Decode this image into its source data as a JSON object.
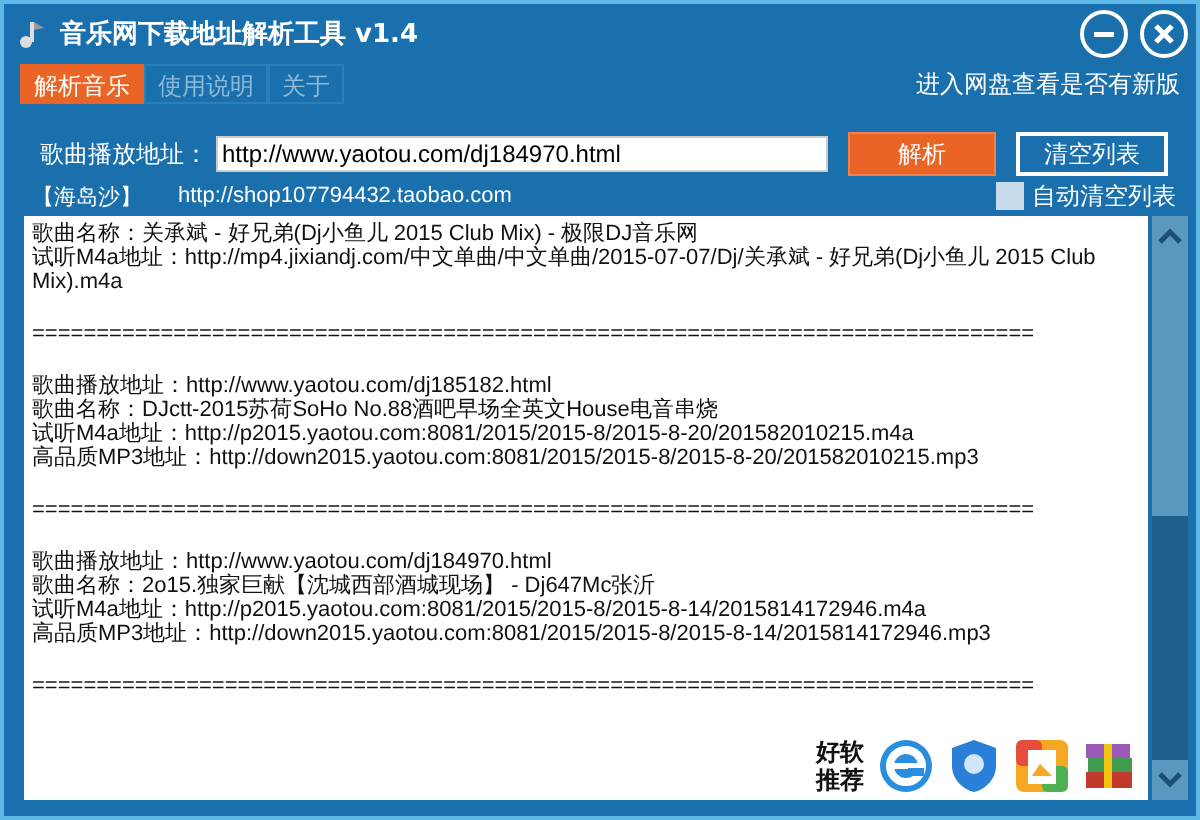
{
  "window": {
    "title": "音乐网下载地址解析工具 v1.4"
  },
  "tabs": [
    {
      "label": "解析音乐",
      "selected": true
    },
    {
      "label": "使用说明",
      "selected": false
    },
    {
      "label": "关于",
      "selected": false
    }
  ],
  "update_link": "进入网盘查看是否有新版",
  "url_label": "歌曲播放地址：",
  "url_value": "http://www.yaotou.com/dj184970.html",
  "parse_button": "解析",
  "clear_button": "清空列表",
  "shop_name": "【海岛沙】",
  "shop_link": "http://shop107794432.taobao.com",
  "auto_clear": {
    "label": "自动清空列表",
    "checked": false
  },
  "log": [
    {
      "kind": "entry",
      "lines": [
        "歌曲名称：关承斌 - 好兄弟(Dj小鱼儿 2015 Club Mix) - 极限DJ音乐网",
        "试听M4a地址：http://mp4.jixiandj.com/中文单曲/中文单曲/2015-07-07/Dj/关承斌 - 好兄弟(Dj小鱼儿 2015 Club Mix).m4a"
      ]
    },
    {
      "kind": "separator",
      "text": "=============================================================================="
    },
    {
      "kind": "entry",
      "lines": [
        "歌曲播放地址：http://www.yaotou.com/dj185182.html",
        "歌曲名称：DJctt-2015苏荷SoHo No.88酒吧早场全英文House电音串烧",
        "试听M4a地址：http://p2015.yaotou.com:8081/2015/2015-8/2015-8-20/201582010215.m4a",
        "高品质MP3地址：http://down2015.yaotou.com:8081/2015/2015-8/2015-8-20/201582010215.mp3"
      ]
    },
    {
      "kind": "separator",
      "text": "=============================================================================="
    },
    {
      "kind": "entry",
      "lines": [
        "歌曲播放地址：http://www.yaotou.com/dj184970.html",
        "歌曲名称：2o15.独家巨献【沈城西部酒城现场】 - Dj647Mc张沂",
        "试听M4a地址：http://p2015.yaotou.com:8081/2015/2015-8/2015-8-14/2015814172946.m4a",
        "高品质MP3地址：http://down2015.yaotou.com:8081/2015/2015-8/2015-8-14/2015814172946.mp3"
      ]
    },
    {
      "kind": "separator",
      "text": "=============================================================================="
    }
  ],
  "recommend_label": "好软推荐"
}
